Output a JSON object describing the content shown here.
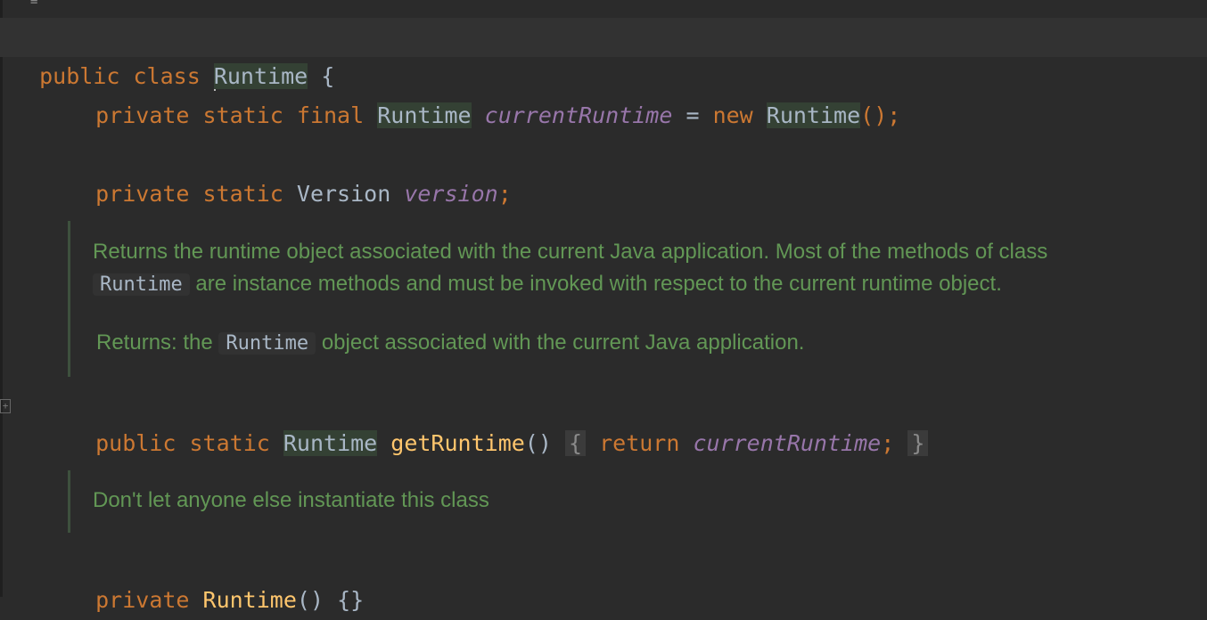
{
  "line1": {
    "kw_public": "public",
    "kw_class": "class",
    "class_name": "Runtime",
    "brace": "{"
  },
  "line2": {
    "kw_private": "private",
    "kw_static": "static",
    "kw_final": "final",
    "type": "Runtime",
    "field": "currentRuntime",
    "eq": "=",
    "kw_new": "new",
    "ctor": "Runtime",
    "tail": "();"
  },
  "line3": {
    "kw_private": "private",
    "kw_static": "static",
    "type": "Version",
    "field": "version",
    "semi": ";"
  },
  "doc1": {
    "text1": "Returns the runtime object associated with the current Java application. Most of the methods of class",
    "code1": "Runtime",
    "text2": "are instance methods and must be invoked with respect to the current runtime object.",
    "label": "Returns:",
    "text3": "the",
    "code2": "Runtime",
    "text4": "object associated with the current Java application."
  },
  "line4": {
    "kw_public": "public",
    "kw_static": "static",
    "type": "Runtime",
    "method": "getRuntime",
    "parens": "()",
    "lbrace": "{",
    "kw_return": "return",
    "field": "currentRuntime",
    "semi": ";",
    "rbrace": "}"
  },
  "doc2": {
    "text": "Don't let anyone else instantiate this class"
  },
  "line5": {
    "kw_private": "private",
    "ctor": "Runtime",
    "parens": "()",
    "body": "{}"
  }
}
